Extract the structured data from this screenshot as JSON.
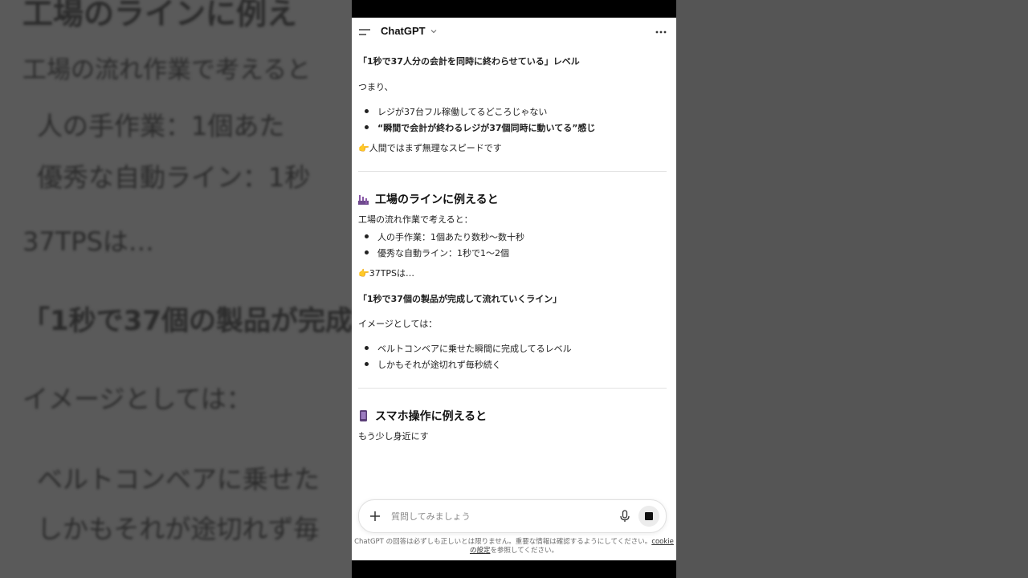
{
  "background_echo": {
    "line1": "工場のラインに例え",
    "line2": "工場の流れ作業で考えると",
    "line3": "人の手作業：1個あた",
    "line4": "優秀な自動ライン：1秒",
    "line5": "37TPSは…",
    "line6": "「1秒で37個の製品が完成し",
    "line7": "イメージとしては：",
    "line8": "ベルトコンベアに乗せた",
    "line9": "しかもそれが途切れず毎"
  },
  "header": {
    "title": "ChatGPT"
  },
  "icons": {
    "menu": "menu-icon",
    "dropdown": "chevron-down-icon",
    "more": "more-icon",
    "factory": "factory-icon",
    "phone": "phone-icon",
    "point": "pointing-hand-icon",
    "plus": "plus-icon",
    "mic": "microphone-icon",
    "stop": "stop-icon"
  },
  "messages": {
    "line_summary1": "「1秒で37人分の会計を同時に終わらせている」レベル",
    "tsumari": "つまり、",
    "bullets1": [
      "レジが37台フル稼働してるどころじゃない",
      "“瞬間で会計が終わるレジが37個同時に動いてる”感じ"
    ],
    "point1": "人間ではまず無理なスピードです",
    "section2_title": "工場のラインに例えると",
    "section2_intro": "工場の流れ作業で考えると：",
    "bullets2": [
      "人の手作業：1個あたり数秒〜数十秒",
      "優秀な自動ライン：1秒で1〜2個"
    ],
    "point2": "37TPSは…",
    "line_summary2": "「1秒で37個の製品が完成して流れていくライン」",
    "image_intro": "イメージとしては：",
    "bullets3": [
      "ベルトコンベアに乗せた瞬間に完成してるレベル",
      "しかもそれが途切れず毎秒続く"
    ],
    "section3_title": "スマホ操作に例えると",
    "section3_partial": "もう少し身近にす"
  },
  "composer": {
    "placeholder": "質問してみましょう"
  },
  "footer": {
    "text_before": "ChatGPT の回答は必ずしも正しいとは限りません。重要な情報は確認するようにしてください。",
    "link": "cookie の設定",
    "text_after": "を参照してください。"
  },
  "colors": {
    "accent_text": "#111111",
    "muted": "#6b6b6b",
    "stop_bg": "#ececec"
  }
}
